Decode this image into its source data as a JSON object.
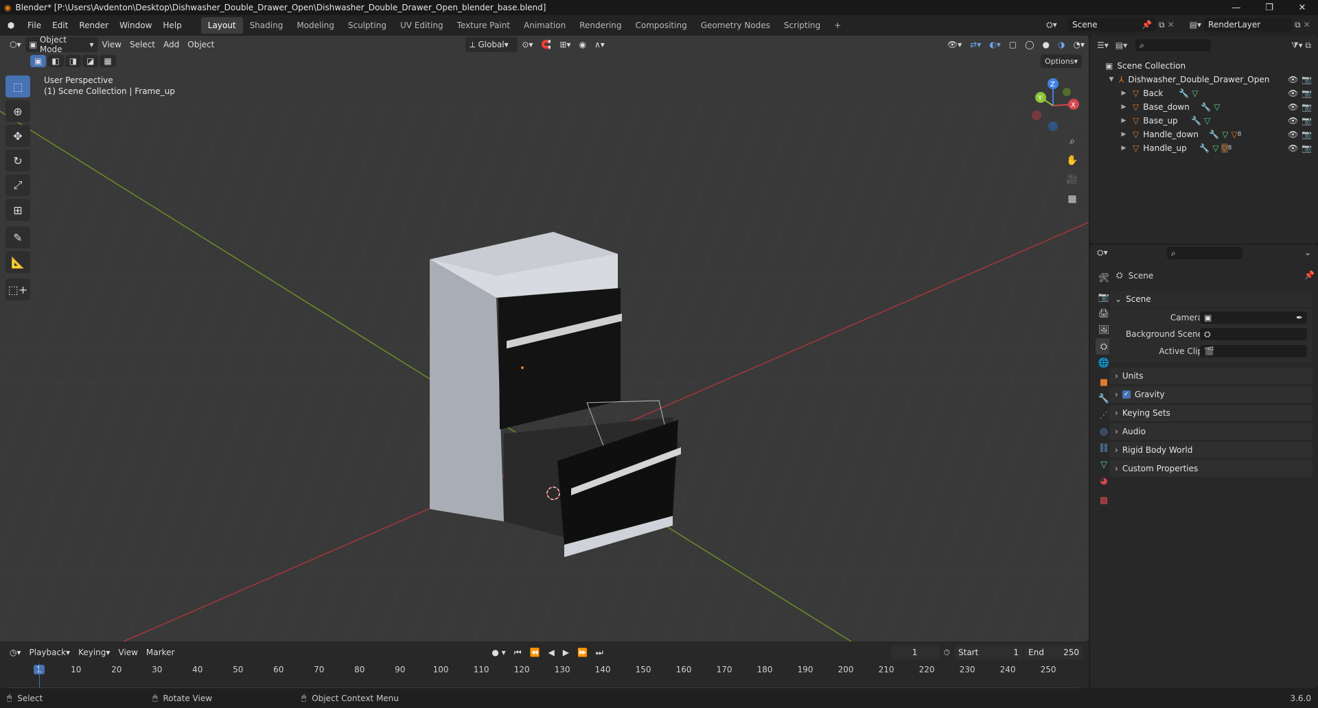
{
  "window": {
    "title": "Blender* [P:\\Users\\Avdenton\\Desktop\\Dishwasher_Double_Drawer_Open\\Dishwasher_Double_Drawer_Open_blender_base.blend]",
    "minimize": "—",
    "maximize": "❐",
    "close": "✕"
  },
  "menubar": {
    "menus": [
      "File",
      "Edit",
      "Render",
      "Window",
      "Help"
    ],
    "workspaces": [
      "Layout",
      "Shading",
      "Modeling",
      "Sculpting",
      "UV Editing",
      "Texture Paint",
      "Animation",
      "Rendering",
      "Compositing",
      "Geometry Nodes",
      "Scripting"
    ],
    "add_tab": "+",
    "scene": "Scene",
    "view_layer": "RenderLayer"
  },
  "viewport": {
    "mode": "Object Mode",
    "menus": [
      "View",
      "Select",
      "Add",
      "Object"
    ],
    "orientation": "Global",
    "options": "Options",
    "overlay_title": "User Perspective",
    "overlay_sub": "(1) Scene Collection | Frame_up",
    "gizmo": {
      "z": "Z",
      "y": "Y",
      "x": "X"
    }
  },
  "outliner": {
    "root": "Scene Collection",
    "collection": "Dishwasher_Double_Drawer_Open",
    "objects": [
      "Back",
      "Base_down",
      "Base_up",
      "Handle_down",
      "Handle_up"
    ],
    "handle_down_badge": "8",
    "handle_up_badge": "8"
  },
  "properties": {
    "header": "Scene",
    "section": "Scene",
    "fields": [
      {
        "label": "Camera",
        "value": ""
      },
      {
        "label": "Background Scene",
        "value": ""
      },
      {
        "label": "Active Clip",
        "value": ""
      }
    ],
    "panels": [
      "Units",
      "Gravity",
      "Keying Sets",
      "Audio",
      "Rigid Body World",
      "Custom Properties"
    ],
    "gravity_checked": true
  },
  "timeline": {
    "menus": [
      "Playback",
      "Keying",
      "View",
      "Marker"
    ],
    "current_frame": "1",
    "start_label": "Start",
    "start": "1",
    "end_label": "End",
    "end": "250",
    "ticks": [
      "1",
      "10",
      "20",
      "30",
      "40",
      "50",
      "60",
      "70",
      "80",
      "90",
      "100",
      "110",
      "120",
      "130",
      "140",
      "150",
      "160",
      "170",
      "180",
      "190",
      "200",
      "210",
      "220",
      "230",
      "240",
      "250"
    ]
  },
  "statusbar": {
    "select": "Select",
    "rotate": "Rotate View",
    "context": "Object Context Menu",
    "version": "3.6.0"
  },
  "colors": {
    "accent": "#4772b3",
    "x_axis": "#d2474e",
    "y_axis": "#8dc43a",
    "z_axis": "#3f83e1",
    "object_icon": "#e07a2b"
  }
}
